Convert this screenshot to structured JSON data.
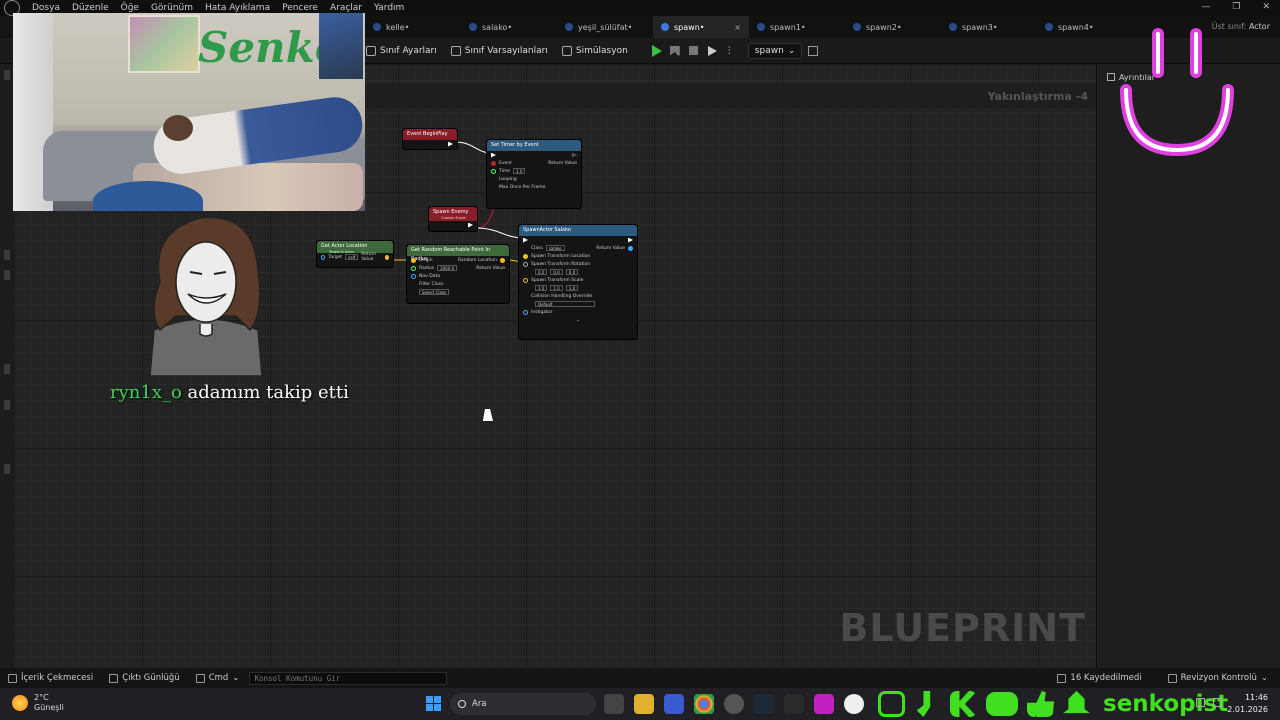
{
  "menu": [
    "Dosya",
    "Düzenle",
    "Öğe",
    "Görünüm",
    "Hata Ayıklama",
    "Pencere",
    "Araçlar",
    "Yardım"
  ],
  "tabs": [
    {
      "label": "kelle•",
      "active": false
    },
    {
      "label": "salako•",
      "active": false
    },
    {
      "label": "yeşil_sülüfat•",
      "active": false
    },
    {
      "label": "spawn•",
      "active": true
    },
    {
      "label": "spawn1•",
      "active": false
    },
    {
      "label": "spawn2•",
      "active": false
    },
    {
      "label": "spawn3•",
      "active": false
    },
    {
      "label": "spawn4•",
      "active": false
    }
  ],
  "tab_close": "×",
  "parent_class": {
    "label": "Üst sınıf:",
    "value": "Actor"
  },
  "toolbar": {
    "class_settings": "Sınıf Ayarları",
    "class_defaults": "Sınıf Varsayılanları",
    "simulation": "Simülasyon",
    "debug_object": "spawn"
  },
  "graph": {
    "zoom": "Yakınlaştırma -4",
    "watermark": "BLUEPRINT",
    "nodes": {
      "begin_play": {
        "title": "Event BeginPlay"
      },
      "set_timer": {
        "title": "Set Timer by Event",
        "event": "Event",
        "time_label": "Time",
        "time_value": "1.0",
        "looping": "Looping",
        "max_once": "Max Once Per Frame",
        "return": "Return Value"
      },
      "spawn_enemy": {
        "title": "Spawn Enemy",
        "subtitle": "Custom Event"
      },
      "get_actor_location": {
        "title": "Get Actor Location",
        "subtitle": "Target is Actor",
        "target": "Target",
        "target_value": "self",
        "return": "Return Value"
      },
      "random_point": {
        "title": "Get Random Reachable Point In Radius",
        "origin": "Origin",
        "radius": "Radius",
        "radius_value": "2000.0",
        "nav_data": "Nav Data",
        "filter": "Filter Class",
        "filter_value": "Select Class",
        "random_location": "Random Location",
        "return": "Return Value"
      },
      "spawn_actor": {
        "title": "SpawnActor Salako",
        "class": "Class",
        "class_value": "salako",
        "loc": "Spawn Transform Location",
        "rot": "Spawn Transform Rotation",
        "rot_values": [
          "0.0",
          "0.0",
          "0.0"
        ],
        "scale": "Spawn Transform Scale",
        "scale_values": [
          "1.0",
          "1.0",
          "1.0"
        ],
        "collision": "Collision Handling Override",
        "collision_value": "Default",
        "instigator": "Instigator",
        "return": "Return Value"
      }
    }
  },
  "details": {
    "tab": "Ayrıntılar"
  },
  "statusbar": {
    "content_drawer": "İçerik Çekmecesi",
    "output_log": "Çıktı Günlüğü",
    "cmd": "Cmd",
    "console_placeholder": "Konsol Komutunu Gir",
    "unsaved": "16 Kaydedilmedi",
    "revision": "Revizyon Kontrolü"
  },
  "overlay": {
    "follow_user": "ryn1x_o",
    "follow_text": " adamım takip etti",
    "brand": "senkopist",
    "cam_graffiti": "Senko"
  },
  "taskbar": {
    "weather_temp": "2°C",
    "weather_desc": "Güneşli",
    "search": "Ara",
    "time": "11:46",
    "date": "2.01.2026"
  },
  "colors": {
    "accent_green": "#40e020",
    "exec_red": "#a0202a",
    "func_blue": "#2f5a80",
    "smile_pink": "#e040e0"
  }
}
